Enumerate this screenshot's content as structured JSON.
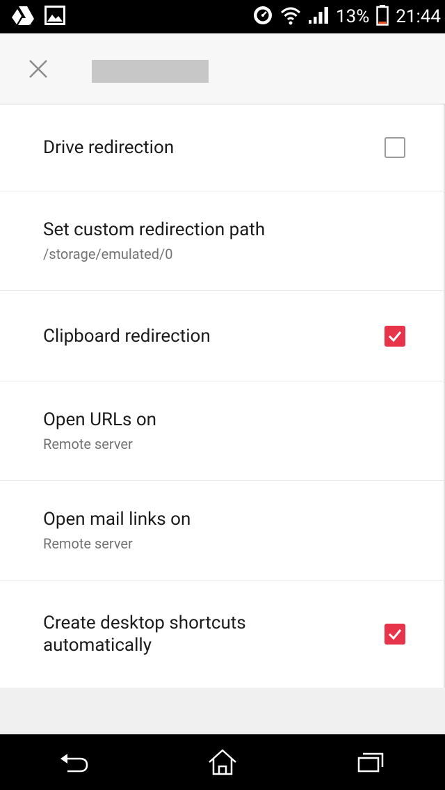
{
  "status_bar": {
    "battery_percent": "13%",
    "time": "21:44",
    "icons": [
      "drive-icon",
      "image-icon",
      "speedometer-icon",
      "wifi-icon",
      "signal-icon",
      "battery-icon"
    ]
  },
  "toolbar": {
    "close_icon": "close-icon"
  },
  "settings": [
    {
      "title": "Drive redirection",
      "subtitle": "",
      "checkbox": "unchecked"
    },
    {
      "title": "Set custom redirection path",
      "subtitle": "/storage/emulated/0",
      "checkbox": "none"
    },
    {
      "title": "Clipboard redirection",
      "subtitle": "",
      "checkbox": "checked"
    },
    {
      "title": "Open URLs on",
      "subtitle": "Remote server",
      "checkbox": "none"
    },
    {
      "title": "Open mail links on",
      "subtitle": "Remote server",
      "checkbox": "none"
    },
    {
      "title": "Create desktop shortcuts automatically",
      "subtitle": "",
      "checkbox": "checked"
    }
  ],
  "colors": {
    "accent": "#e8344b",
    "status_bar": "#000000",
    "toolbar": "#f7f7f7"
  },
  "navbar": {
    "icons": [
      "back-icon",
      "home-icon",
      "recents-icon"
    ]
  }
}
